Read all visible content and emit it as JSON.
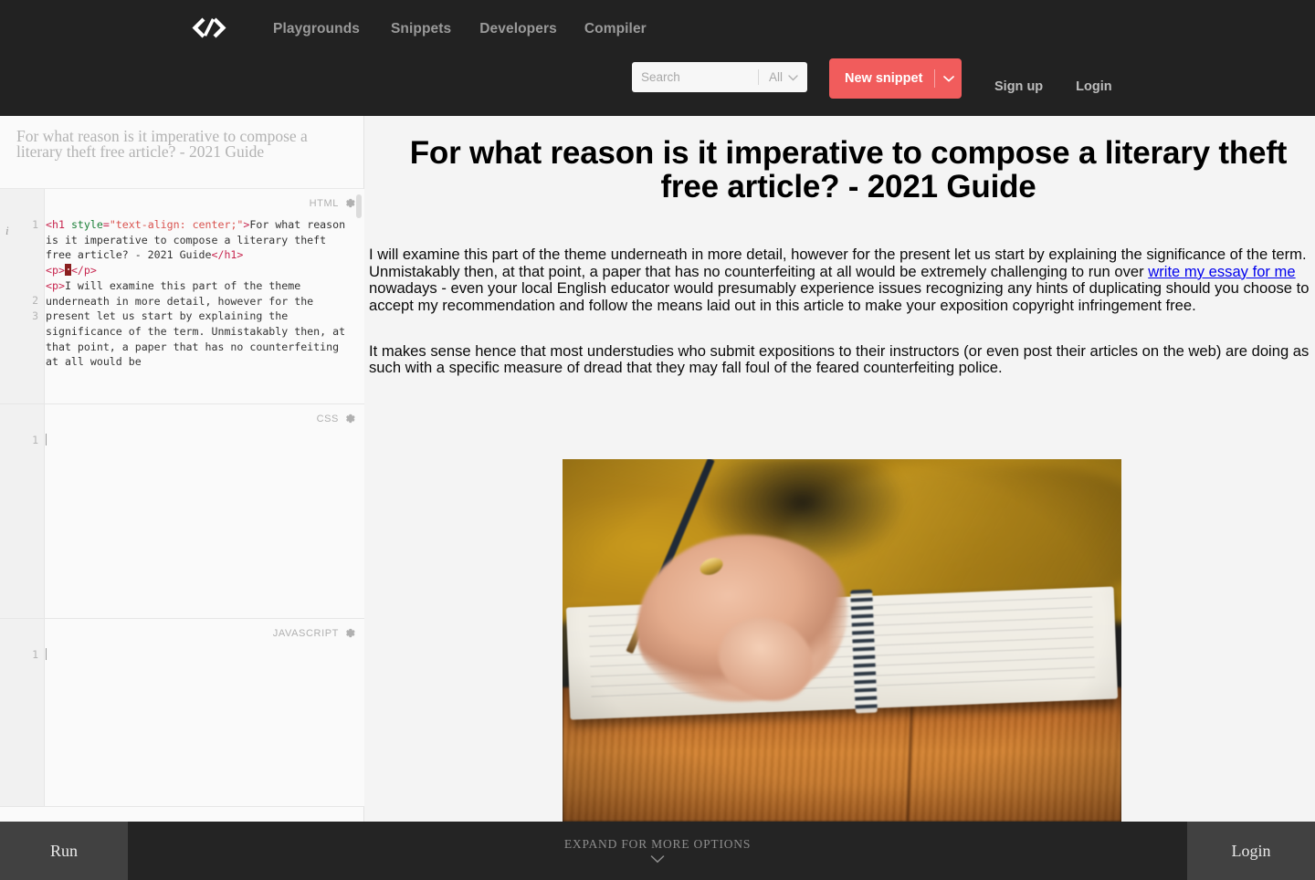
{
  "header": {
    "logo_icon": "code-brackets-logo",
    "nav": [
      {
        "label": "Playgrounds"
      },
      {
        "label": "Snippets"
      },
      {
        "label": "Developers"
      },
      {
        "label": "Compiler"
      }
    ],
    "search": {
      "placeholder": "Search",
      "value": "",
      "scope_label": "All",
      "scope_icon": "chevron-down-icon"
    },
    "new_snippet": {
      "label": "New snippet",
      "caret_icon": "chevron-down-icon",
      "color": "#f15c5c"
    },
    "auth": {
      "signup_label": "Sign up",
      "login_label": "Login"
    },
    "background": "#222222"
  },
  "sidebar": {
    "snippet_title": "For what reason is it imperative to compose a literary theft free article? - 2021 Guide",
    "editors": [
      {
        "lang": "HTML",
        "gear_icon": "gear-icon",
        "line_numbers": [
          "1",
          "2",
          "3"
        ],
        "code_lines": [
          "<h1 style=\"text-align: center;\">For what reason is it imperative to compose a literary theft free article? - 2021 Guide</h1>",
          "<p>&nbsp;</p>",
          "<p>I will examine this part of the theme underneath in more detail, however for the present let us start by explaining the significance of the term. Unmistakably then, at that point, a paper that has no counterfeiting at all would be"
        ]
      },
      {
        "lang": "CSS",
        "gear_icon": "gear-icon",
        "line_numbers": [
          "1"
        ],
        "code_lines": [
          ""
        ]
      },
      {
        "lang": "JAVASCRIPT",
        "gear_icon": "gear-icon",
        "line_numbers": [
          "1"
        ],
        "code_lines": [
          ""
        ]
      }
    ],
    "info_icon": "info-italic-icon"
  },
  "preview": {
    "title": "For what reason is it imperative to compose a literary theft free article? - 2021 Guide",
    "paragraph1_before_link": "I will examine this part of the theme underneath in more detail, however for the present let us start by explaining the significance of the term. Unmistakably then, at that point, a paper that has no counterfeiting at all would be extremely challenging to run over ",
    "paragraph1_link": "write my essay for me",
    "paragraph1_after_link": " nowadays - even your local English educator would presumably experience issues recognizing any hints of duplicating should you choose to accept my recommendation and follow the means laid out in this article to make your exposition copyright infringement free.",
    "paragraph2": "It makes sense hence that most understudies who submit expositions to their instructors (or even post their articles on the web) are doing as such with a specific measure of dread that they may fall foul of the feared counterfeiting police.",
    "image_alt": "hand writing with pencil in a spiral notebook on a wooden desk",
    "link_color": "#0000ee",
    "background": "#f4f4f4"
  },
  "bottom_bar": {
    "run_label": "Run",
    "expand_label": "EXPAND FOR MORE OPTIONS",
    "expand_icon": "chevron-down-icon",
    "login_label": "Login"
  }
}
